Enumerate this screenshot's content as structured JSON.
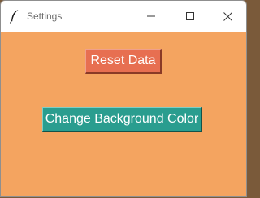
{
  "window": {
    "title": "Settings",
    "background_color": "#f4a460",
    "app_icon": "feather-icon",
    "controls": {
      "minimize_icon": "minimize-icon",
      "maximize_icon": "maximize-icon",
      "close_icon": "close-icon"
    }
  },
  "buttons": {
    "reset_label": "Reset Data",
    "reset_color": "#e76f51",
    "change_bg_label": "Change Background Color",
    "change_bg_color": "#2a9d8f"
  }
}
